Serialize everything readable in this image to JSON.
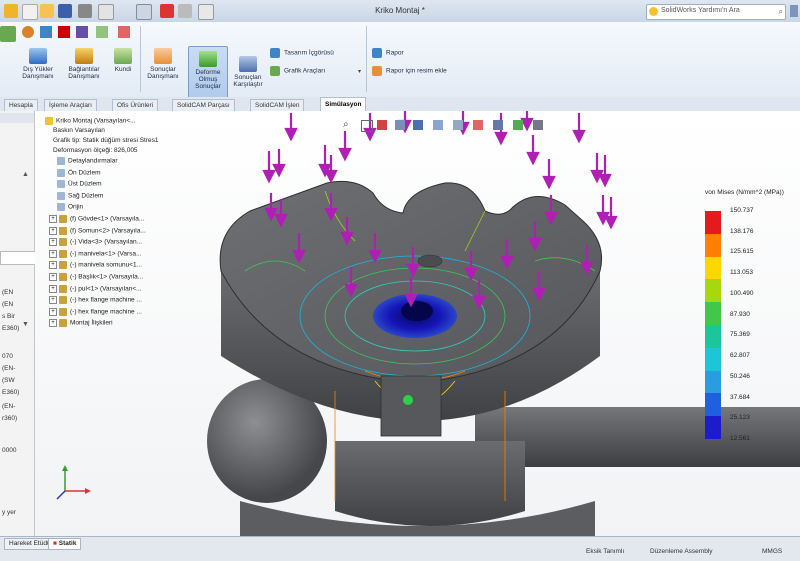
{
  "app": {
    "window_title": "Kriko Montaj *",
    "help_search_placeholder": "SolidWorks Yardımı'n Ara"
  },
  "ribbon": {
    "buttons": [
      {
        "label1": "Dış Yükler",
        "label2": "Danışmanı"
      },
      {
        "label1": "Bağlantılar",
        "label2": "Danışmanı"
      },
      {
        "label1": "Kundi",
        "label2": ""
      },
      {
        "label1": "Sonuçlar",
        "label2": "Danışmanı"
      },
      {
        "label1": "Deforme",
        "label2": "Olmuş",
        "label3": "Sonuçlar"
      },
      {
        "label1": "Sonuçları",
        "label2": "Karşılaştır"
      }
    ],
    "study_items": [
      "Tasarım İçgörüsü",
      "Grafik Araçları"
    ],
    "report_items": [
      "Rapor",
      "Rapor için resim ekle"
    ]
  },
  "tabs": [
    "Hesapla",
    "İşleme Araçları",
    "Ofis Ürünleri",
    "SolidCAM Parçası",
    "SolidCAM İşlen",
    "Simülasyon"
  ],
  "active_tab": "Simülasyon",
  "left_pane": [
    "(EN",
    "(EN",
    "s Bir",
    "E360)",
    "070",
    "(EN-",
    "(SW",
    "E360)",
    "(EN-",
    "r360)",
    "0000",
    "y yer"
  ],
  "tree": {
    "root": "Kriko Montaj (Varsayılan<...",
    "lines": [
      "Baskın Varsayılan",
      "Grafik tip: Statik düğüm stresi Stres1",
      "Deformasyon ölçeği: 826,005"
    ],
    "items": [
      {
        "label": "Detaylandırmalar",
        "expand": false
      },
      {
        "label": "Ön Düzlem",
        "expand": false
      },
      {
        "label": "Üst Düzlem",
        "expand": false
      },
      {
        "label": "Sağ Düzlem",
        "expand": false
      },
      {
        "label": "Orijin",
        "expand": false
      },
      {
        "label": "(f) Gövde<1> (Varsayıla...",
        "expand": true
      },
      {
        "label": "(f) Somun<2> (Varsayıla...",
        "expand": true
      },
      {
        "label": "(-) Vida<3> (Varsayılan...",
        "expand": true
      },
      {
        "label": "(-) manivela<1> (Varsa...",
        "expand": true
      },
      {
        "label": "(-) manivela somunu<1...",
        "expand": true
      },
      {
        "label": "(-) Başlık<1> (Varsayıla...",
        "expand": true
      },
      {
        "label": "(-) pul<1> (Varsayılan<...",
        "expand": true
      },
      {
        "label": "(-) hex flange machine ...",
        "expand": true
      },
      {
        "label": "(-) hex flange machine ...",
        "expand": true
      },
      {
        "label": "Montaj İlişkileri",
        "expand": true
      }
    ]
  },
  "legend": {
    "title": "von Mises (N/mm^2 (MPa))",
    "ticks": [
      "150.737",
      "138.176",
      "125.615",
      "113.053",
      "100.490",
      "87.930",
      "75.369",
      "62.807",
      "50.246",
      "37.684",
      "25.123",
      "12.561"
    ],
    "colors": [
      "#e41a1c",
      "#ff7f00",
      "#ffd700",
      "#a6d80b",
      "#41c84a",
      "#19c79a",
      "#1cc6d8",
      "#2a9de0",
      "#1f5fe0",
      "#1c1ccf"
    ]
  },
  "status": {
    "bottom_tabs": [
      "Hareket Etüdü 1",
      "Statik"
    ],
    "items": [
      "Eksik Tanımlı",
      "Düzenleme Assembly",
      "MMGS"
    ]
  },
  "colors": {
    "accent": "#3a6fb5",
    "arrow": "#b01fb5",
    "part": "#5d5f63"
  }
}
